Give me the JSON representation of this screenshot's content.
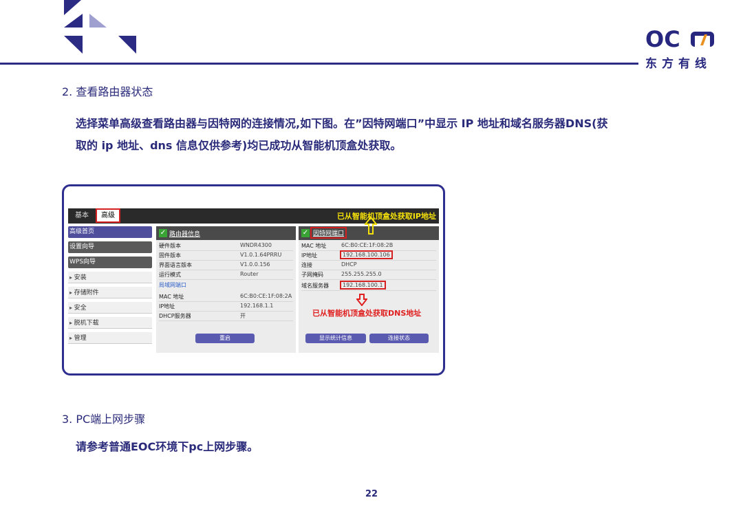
{
  "header": {
    "brand_mark": "OCN",
    "brand_name": "东方有线"
  },
  "section1": {
    "title": "2. 查看路由器状态",
    "line1": "选择菜单高级查看路由器与因特网的连接情况,如下图。在”因特网端口”中显示 IP 地址和域名服务器DNS(获",
    "line2": "取的 ip 地址、dns 信息仅供参考)均已成功从智能机顶盒处获取。"
  },
  "router": {
    "tabs": {
      "basic": "基本",
      "advanced": "高级"
    },
    "ip_note": "已从智能机顶盒处获取IP地址",
    "dns_note": "已从智能机顶盒处获取DNS地址",
    "sidebar": [
      "高级首页",
      "设置向导",
      "WPS向导",
      "安装",
      "存储附件",
      "安全",
      "脱机下载",
      "管理"
    ],
    "router_info": {
      "title": "路由器信息",
      "rows": [
        {
          "key": "硬件版本",
          "value": "WNDR4300"
        },
        {
          "key": "固件版本",
          "value": "V1.0.1.64PRRU"
        },
        {
          "key": "界面语言版本",
          "value": "V1.0.0.156"
        },
        {
          "key": "运行模式",
          "value": "Router"
        }
      ],
      "lan_title": "局域网端口",
      "lan_rows": [
        {
          "key": "MAC 地址",
          "value": "6C:B0:CE:1F:08:2A"
        },
        {
          "key": "IP地址",
          "value": "192.168.1.1"
        },
        {
          "key": "DHCP服务器",
          "value": "开"
        }
      ],
      "button": "重启"
    },
    "internet_port": {
      "title": "因特网端口",
      "rows": [
        {
          "key": "MAC 地址",
          "value": "6C:B0:CE:1F:08:2B"
        },
        {
          "key": "IP地址",
          "value": "192.168.100.106"
        },
        {
          "key": "连接",
          "value": "DHCP"
        },
        {
          "key": "子网掩码",
          "value": "255.255.255.0"
        },
        {
          "key": "域名服务器",
          "value": "192.168.100.1"
        }
      ],
      "button_stats": "显示统计信息",
      "button_status": "连接状态"
    }
  },
  "section2": {
    "title": "3. PC端上网步骤",
    "line1": "请参考普通EOC环境下pc上网步骤。"
  },
  "page_number": "22",
  "colors": {
    "navy": "#2b2b84",
    "red": "#d42020",
    "yellow": "#f5e10a"
  }
}
